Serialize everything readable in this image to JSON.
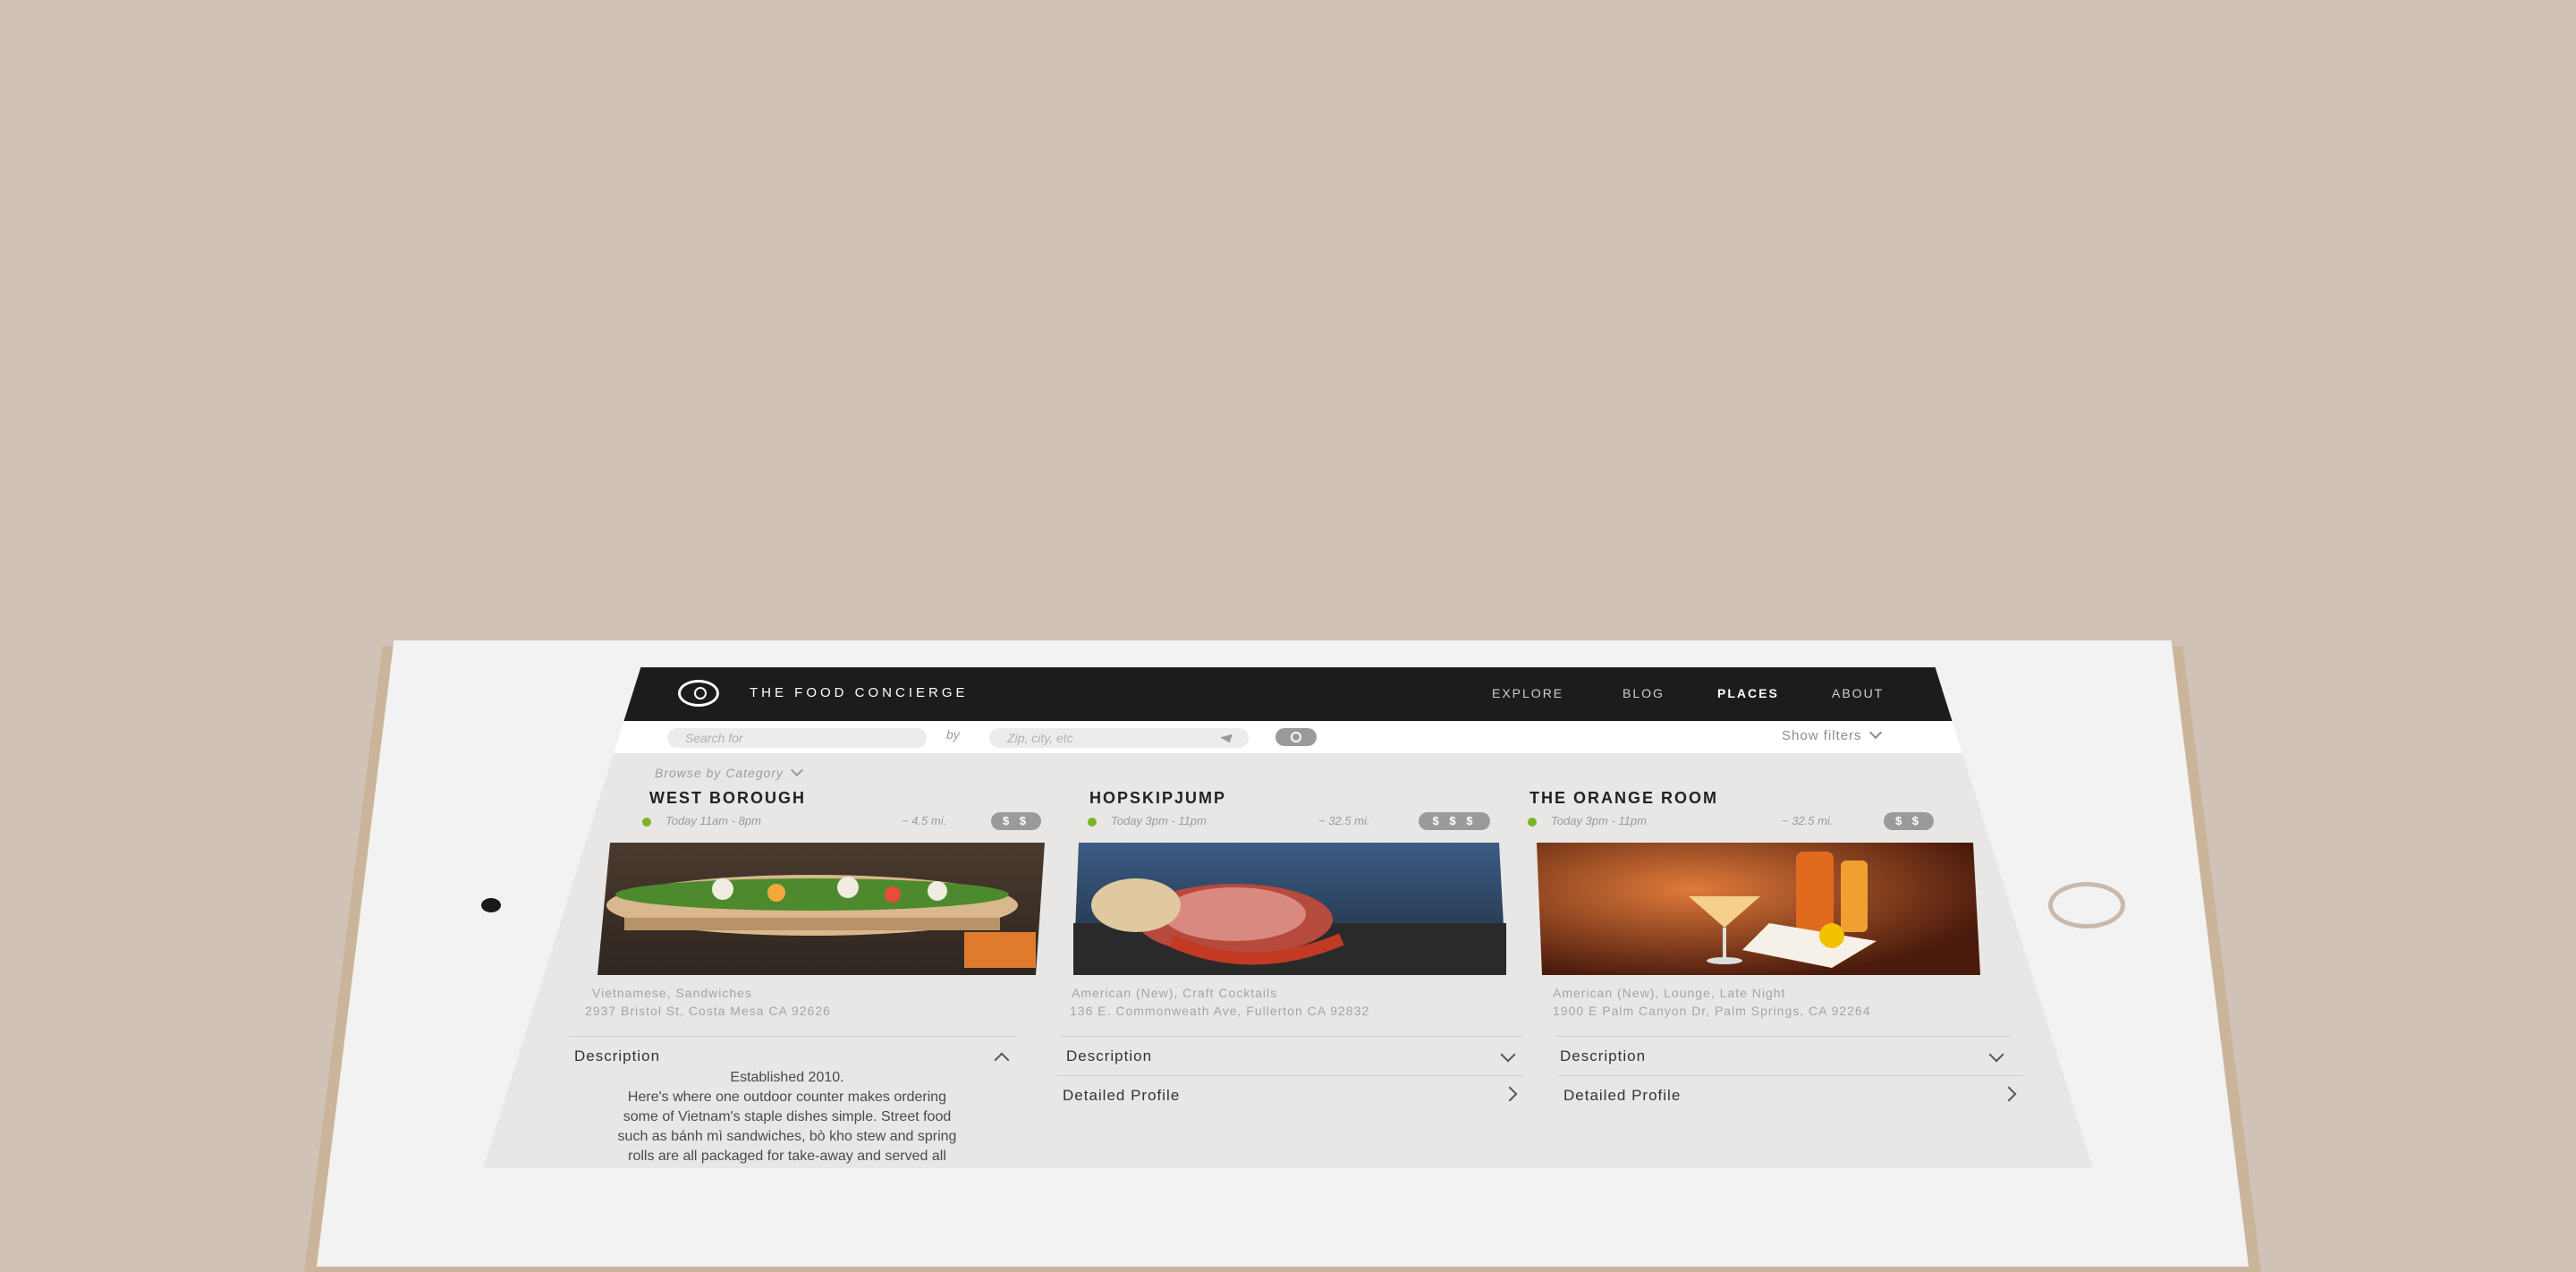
{
  "app": {
    "brand": "THE FOOD CONCIERGE",
    "nav": [
      {
        "label": "EXPLORE"
      },
      {
        "label": "BLOG"
      },
      {
        "label": "PLACES",
        "active": true
      },
      {
        "label": "ABOUT"
      }
    ]
  },
  "search": {
    "what_placeholder": "Search for",
    "by_label": "by",
    "where_placeholder": "Zip, city, etc",
    "filters_label": "Show filters"
  },
  "browse_label": "Browse by Category",
  "cards": [
    {
      "title": "WEST BOROUGH",
      "hours": "Today  11am - 8pm",
      "distance": "~ 4.5 mi.",
      "price": "$ $",
      "categories": "Vietnamese, Sandwiches",
      "address": "2937 Bristol St, Costa Mesa CA 92626",
      "description_label": "Description",
      "description_text": "Established 2010.\nHere's where one outdoor counter makes ordering\nsome of Vietnam's staple dishes simple. Street food\nsuch as bánh mì sandwiches, bò kho stew and spring\nrolls are all packaged for take-away and served all"
    },
    {
      "title": "HOPSKIPJUMP",
      "hours": "Today  3pm - 11pm",
      "distance": "~ 32.5 mi.",
      "price": "$ $ $",
      "categories": "American (New), Craft Cocktails",
      "address": "136 E. Commonweath Ave, Fullerton CA 92832",
      "description_label": "Description",
      "profile_label": "Detailed Profile"
    },
    {
      "title": "THE ORANGE ROOM",
      "hours": "Today  3pm - 11pm",
      "distance": "~ 32.5 mi.",
      "price": "$ $",
      "categories": "American (New), Lounge, Late Night",
      "address": "1900 E Palm Canyon Dr, Palm Springs, CA 92264",
      "description_label": "Description",
      "profile_label": "Detailed Profile"
    }
  ],
  "colors": {
    "background": "#d1c2b8",
    "navbar": "#1c1c1c",
    "open_dot": "#7cb228"
  }
}
